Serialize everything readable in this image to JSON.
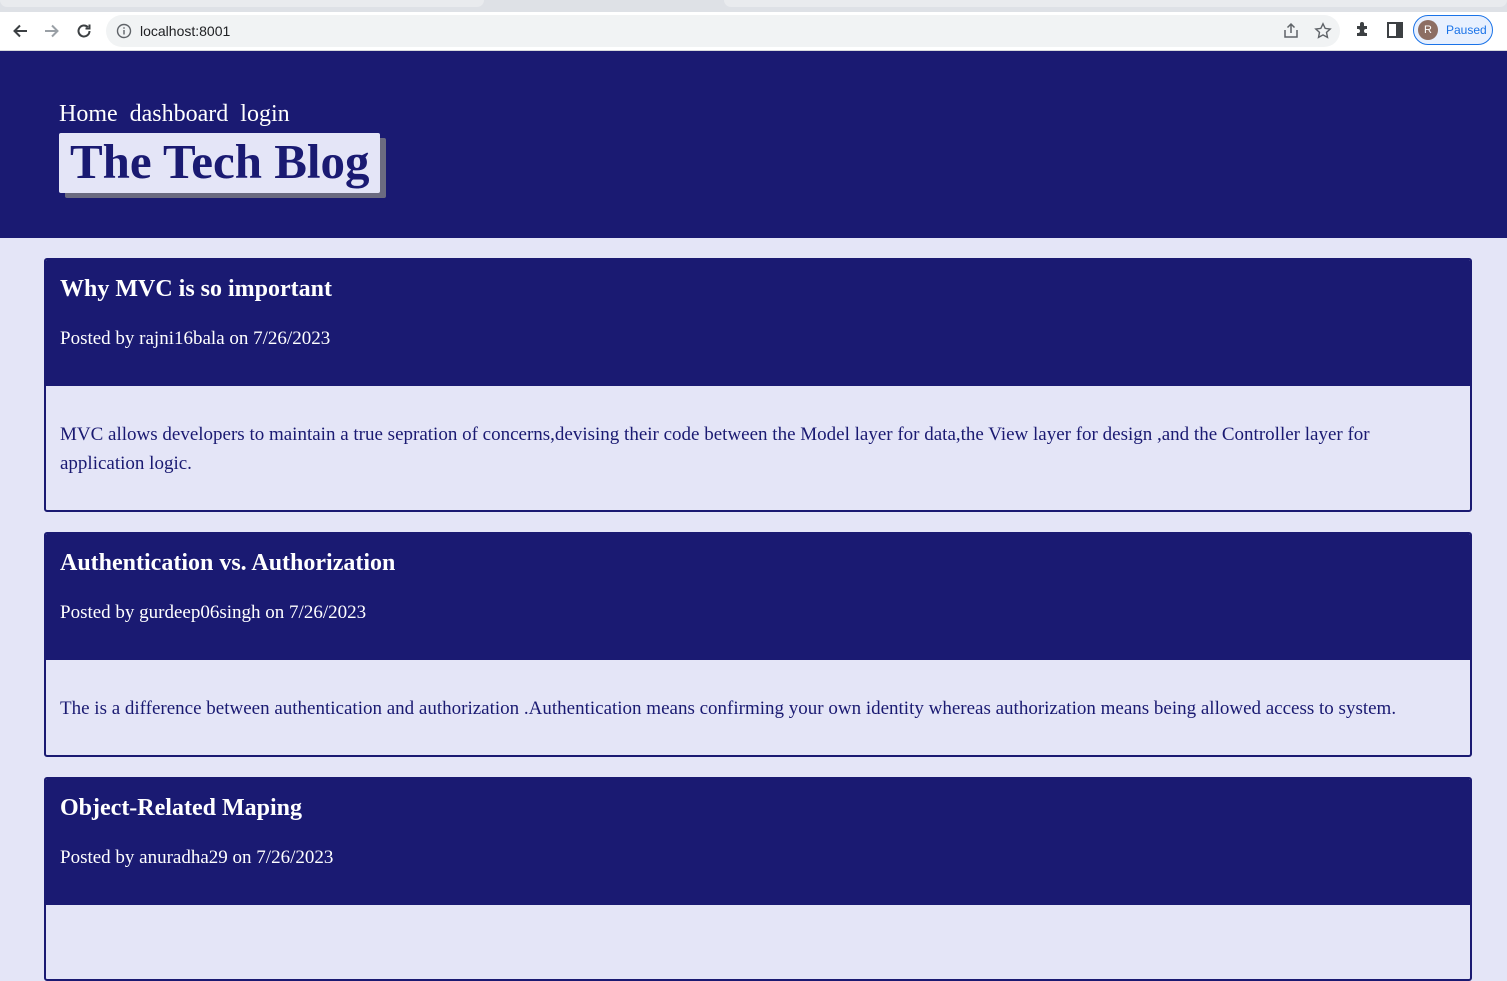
{
  "browser": {
    "url": "localhost:8001",
    "profile_initial": "R",
    "profile_status": "Paused"
  },
  "header": {
    "nav": [
      "Home",
      "dashboard",
      "login"
    ],
    "brand": "The Tech Blog"
  },
  "posts": [
    {
      "title": "Why MVC is so important",
      "meta": "Posted by rajni16bala on 7/26/2023",
      "body": "MVC allows developers to maintain a true sepration of concerns,devising their code between the Model layer for data,the View layer for design ,and the Controller layer for application logic."
    },
    {
      "title": "Authentication vs. Authorization",
      "meta": "Posted by gurdeep06singh on 7/26/2023",
      "body": "The is a difference between authentication and authorization .Authentication means confirming your own identity whereas authorization means being allowed access to system."
    },
    {
      "title": "Object-Related Maping",
      "meta": "Posted by anuradha29 on 7/26/2023",
      "body": ""
    }
  ]
}
